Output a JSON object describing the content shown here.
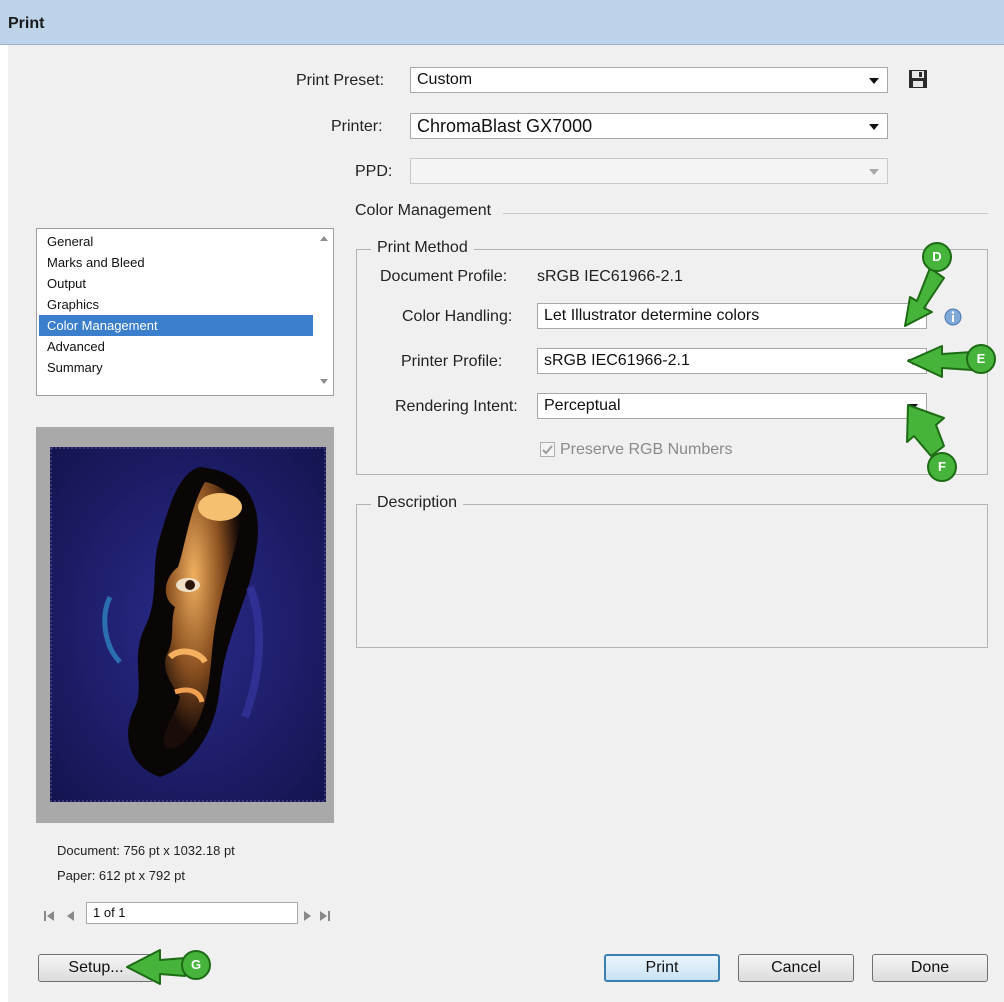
{
  "window": {
    "title": "Print"
  },
  "preset": {
    "label": "Print Preset:",
    "value": "Custom"
  },
  "printer": {
    "label": "Printer:",
    "value": "ChromaBlast GX7000"
  },
  "ppd": {
    "label": "PPD:",
    "value": ""
  },
  "section_title": "Color Management",
  "nav": {
    "items": [
      {
        "label": "General",
        "selected": false
      },
      {
        "label": "Marks and Bleed",
        "selected": false
      },
      {
        "label": "Output",
        "selected": false
      },
      {
        "label": "Graphics",
        "selected": false
      },
      {
        "label": "Color Management",
        "selected": true
      },
      {
        "label": "Advanced",
        "selected": false
      },
      {
        "label": "Summary",
        "selected": false
      }
    ]
  },
  "print_method": {
    "legend": "Print Method",
    "document_profile_label": "Document Profile:",
    "document_profile_value": "sRGB IEC61966-2.1",
    "color_handling_label": "Color Handling:",
    "color_handling_value": "Let Illustrator determine colors",
    "printer_profile_label": "Printer Profile:",
    "printer_profile_value": "sRGB IEC61966-2.1",
    "rendering_intent_label": "Rendering Intent:",
    "rendering_intent_value": "Perceptual",
    "preserve_rgb_label": "Preserve RGB Numbers",
    "preserve_rgb_checked": true
  },
  "description": {
    "legend": "Description"
  },
  "preview": {
    "document": "Document: 756 pt x 1032.18 pt",
    "paper": "Paper: 612 pt x 792 pt",
    "page": "1 of 1"
  },
  "buttons": {
    "setup": "Setup...",
    "print": "Print",
    "cancel": "Cancel",
    "done": "Done"
  },
  "callouts": {
    "d": "D",
    "e": "E",
    "f": "F",
    "g": "G"
  },
  "colors": {
    "callout": "#46b33a",
    "selection": "#3a7ecc",
    "titlebar": "#bcd3ea"
  },
  "icons": [
    "save-preset-icon",
    "info-icon",
    "checkbox-check-icon",
    "first-page-icon",
    "prev-page-icon",
    "next-page-icon",
    "last-page-icon"
  ]
}
